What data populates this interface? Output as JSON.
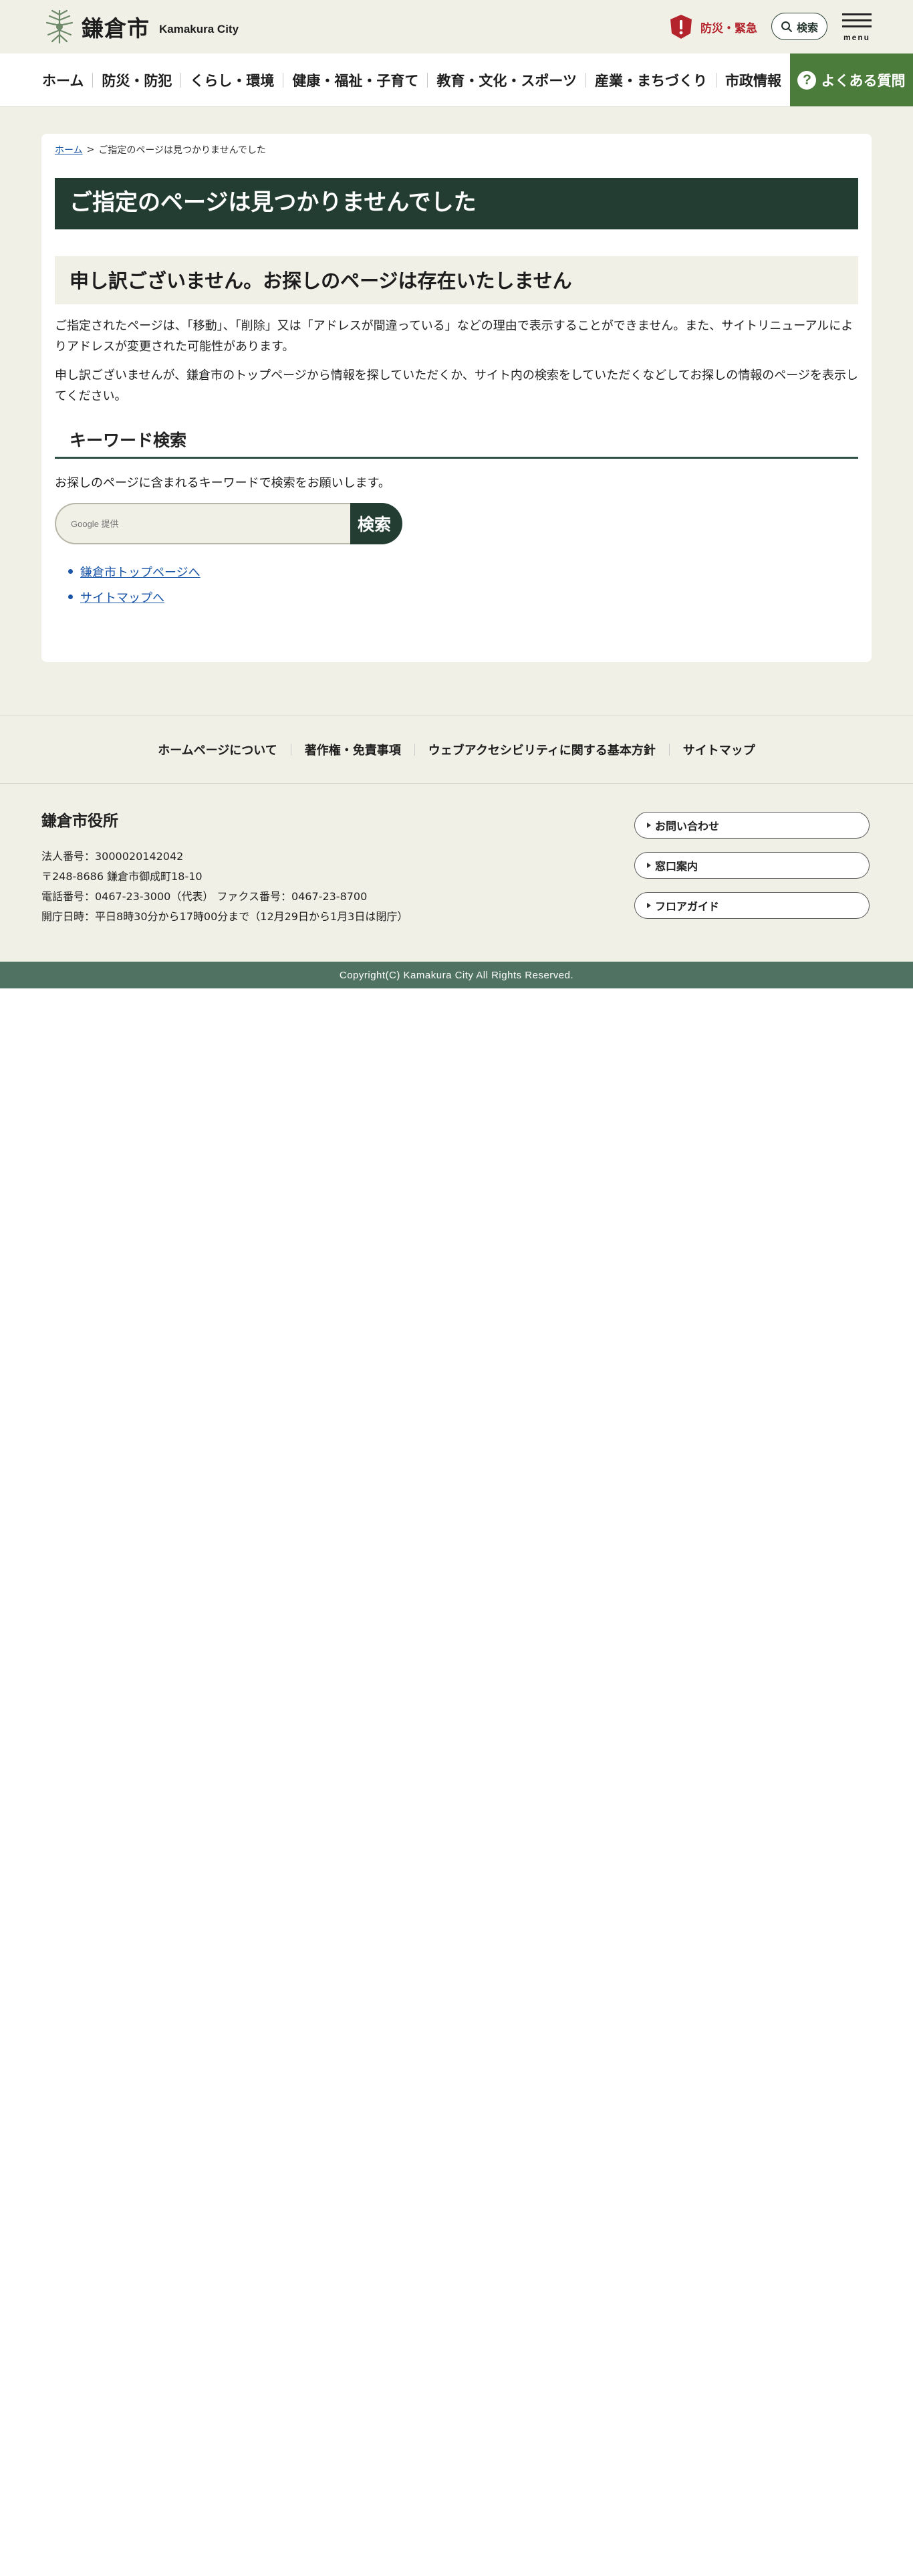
{
  "header": {
    "logo_ja": "鎌倉市",
    "logo_en": "Kamakura City",
    "emergency_label": "防災・緊急",
    "search_label": "検索",
    "menu_label": "menu"
  },
  "nav": {
    "items": [
      "ホーム",
      "防災・防犯",
      "くらし・環境",
      "健康・福祉・子育て",
      "教育・文化・スポーツ",
      "産業・まちづくり",
      "市政情報"
    ],
    "faq_label": "よくある質問"
  },
  "breadcrumb": {
    "home": "ホーム",
    "separator": ">",
    "current": "ご指定のページは見つかりませんでした"
  },
  "main": {
    "title": "ご指定のページは見つかりませんでした",
    "subheading": "申し訳ございません。お探しのページは存在いたしません",
    "paragraph1": "ご指定されたページは、「移動」、「削除」又は「アドレスが間違っている」などの理由で表示することができません。また、サイトリニューアルによりアドレスが変更された可能性があります。",
    "paragraph2": "申し訳ございませんが、鎌倉市のトップページから情報を探していただくか、サイト内の検索をしていただくなどしてお探しの情報のページを表示してください。",
    "keyword_heading": "キーワード検索",
    "keyword_intro": "お探しのページに含まれるキーワードで検索をお願いします。",
    "search_placeholder": "Google 提供",
    "search_button": "検索",
    "links": [
      "鎌倉市トップページへ",
      "サイトマップへ"
    ]
  },
  "footer": {
    "links": [
      "ホームページについて",
      "著作権・免責事項",
      "ウェブアクセシビリティに関する基本方針",
      "サイトマップ"
    ],
    "org_name": "鎌倉市役所",
    "corporate_number": "法人番号：3000020142042",
    "address": "〒248-8686 鎌倉市御成町18-10",
    "phone": "電話番号：0467-23-3000（代表） ファクス番号：0467-23-8700",
    "hours": "開庁日時：平日8時30分から17時00分まで（12月29日から1月3日は閉庁）",
    "buttons": [
      "お問い合わせ",
      "窓口案内",
      "フロアガイド"
    ],
    "copyright": "Copyright(C) Kamakura City All Rights Reserved."
  },
  "colors": {
    "accent_dark": "#233d33",
    "faq_green": "#4c7c3b",
    "emergency_red": "#b3242c",
    "page_bg": "#f1f0e7",
    "copyright_bar": "#4f7263",
    "link_blue": "#1a56a8"
  },
  "icons": [
    "kamakura-logo-icon",
    "alert-icon",
    "search-icon",
    "hamburger-icon",
    "question-icon"
  ]
}
